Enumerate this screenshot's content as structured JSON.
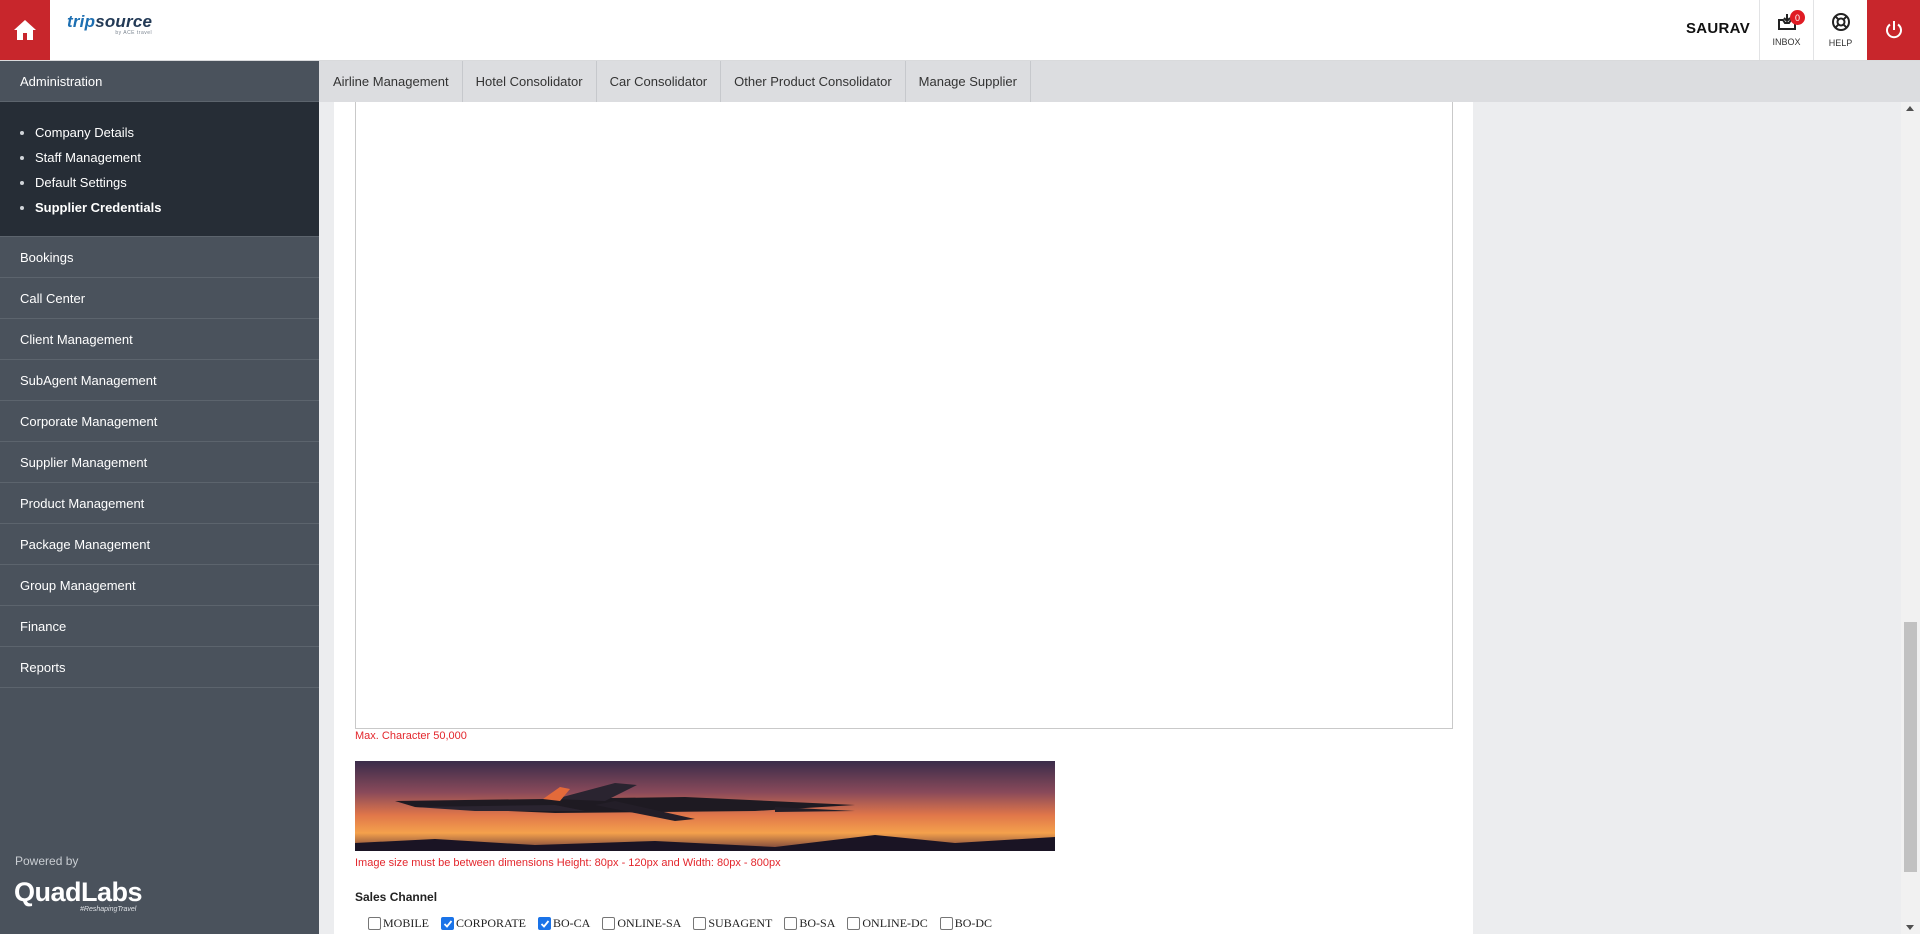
{
  "header": {
    "brand_trip": "trip",
    "brand_source": "source",
    "brand_sub": "by ACE travel",
    "username": "SAURAV",
    "inbox_label": "INBOX",
    "inbox_count": "0",
    "help_label": "HELP"
  },
  "sidebar": {
    "section_title": "Administration",
    "sub_items": [
      {
        "label": "Company Details"
      },
      {
        "label": "Staff Management"
      },
      {
        "label": "Default Settings"
      },
      {
        "label": "Supplier Credentials",
        "active": true
      }
    ],
    "items": [
      {
        "label": "Bookings"
      },
      {
        "label": "Call Center"
      },
      {
        "label": "Client Management"
      },
      {
        "label": "SubAgent Management"
      },
      {
        "label": "Corporate Management"
      },
      {
        "label": "Supplier Management"
      },
      {
        "label": "Product Management"
      },
      {
        "label": "Package Management"
      },
      {
        "label": "Group Management"
      },
      {
        "label": "Finance"
      },
      {
        "label": "Reports"
      }
    ],
    "powered_by": "Powered by",
    "quadlabs_logo": "QuadLabs",
    "quadlabs_tag": "#ReshapingTravel"
  },
  "tabs": [
    {
      "label": "Airline Management"
    },
    {
      "label": "Hotel Consolidator"
    },
    {
      "label": "Car Consolidator"
    },
    {
      "label": "Other Product Consolidator"
    },
    {
      "label": "Manage Supplier"
    }
  ],
  "main": {
    "max_char_note": "Max. Character 50,000",
    "image_note": "Image size must be between dimensions Height: 80px - 120px and Width: 80px - 800px",
    "sales_channel_title": "Sales Channel",
    "channels": [
      {
        "label": "MOBILE",
        "checked": false
      },
      {
        "label": "CORPORATE",
        "checked": true
      },
      {
        "label": "BO-CA",
        "checked": true
      },
      {
        "label": "ONLINE-SA",
        "checked": false
      },
      {
        "label": "SUBAGENT",
        "checked": false
      },
      {
        "label": "BO-SA",
        "checked": false
      },
      {
        "label": "ONLINE-DC",
        "checked": false
      },
      {
        "label": "BO-DC",
        "checked": false
      }
    ]
  },
  "colors": {
    "brand_red": "#c8262c",
    "sidebar_bg": "#4a525c",
    "sidebar_sub_bg": "#262d36",
    "note_red": "#e3262c",
    "checkbox_blue": "#1a73e8"
  },
  "icons": {
    "home": "home-icon",
    "inbox": "inbox-icon",
    "help": "lifebuoy-icon",
    "power": "power-icon"
  }
}
